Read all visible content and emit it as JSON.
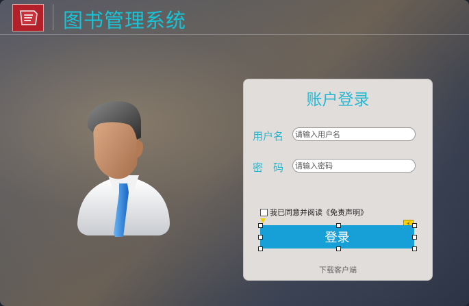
{
  "header": {
    "title": "图书管理系统",
    "logo_icon": "book-icon"
  },
  "avatar": {
    "icon": "user-avatar-icon"
  },
  "login": {
    "title": "账户登录",
    "username_label": "用户名",
    "username_placeholder": "请输入用户名",
    "password_label": "密　码",
    "password_placeholder": "请输入密码",
    "agree_text": "我已同意并阅读《免责声明》",
    "agree_checked": false,
    "login_button": "登录",
    "download_link": "下载客户端"
  },
  "colors": {
    "accent": "#19c3d6",
    "button": "#179fd8",
    "card": "#e1dddb"
  }
}
